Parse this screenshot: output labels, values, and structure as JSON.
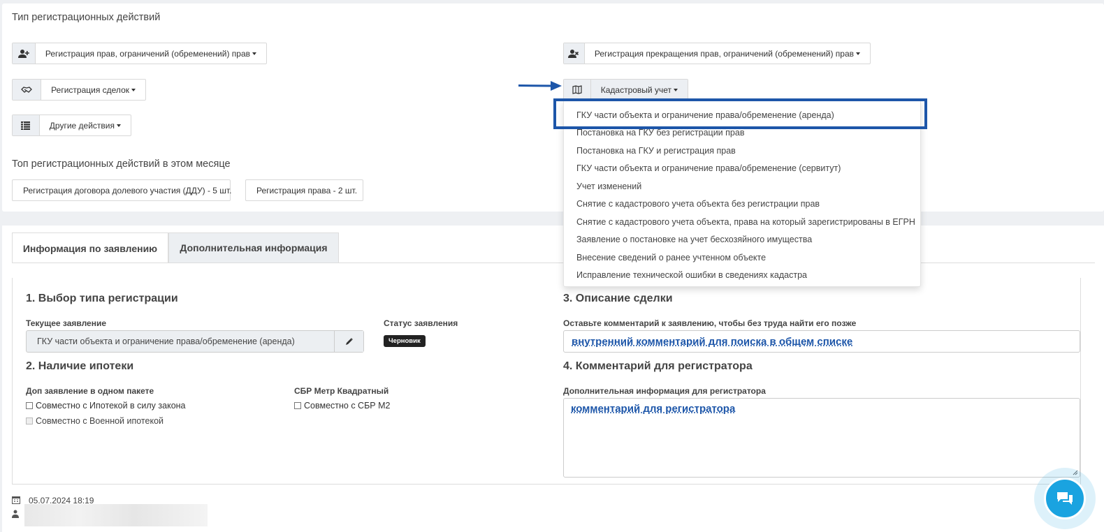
{
  "registration_types": {
    "title": "Тип регистрационных действий",
    "rights_reg": {
      "label": "Регистрация прав, ограничений (обременений) прав"
    },
    "rights_term": {
      "label": "Регистрация прекращения прав, ограничений (обременений) прав"
    },
    "deals": {
      "label": "Регистрация сделок"
    },
    "cadastral": {
      "label": "Кадастровый учет"
    },
    "other": {
      "label": "Другие действия"
    }
  },
  "top_month": {
    "title": "Топ регистрационных действий в этом месяце",
    "items": [
      "Регистрация договора долевого участия (ДДУ) - 5 шт.",
      "Регистрация права - 2 шт."
    ]
  },
  "cadastral_menu": [
    "ГКУ части объекта и ограничение права/обременение (аренда)",
    "Постановка на ГКУ без регистрации прав",
    "Постановка на ГКУ и регистрация прав",
    "ГКУ части объекта и ограничение права/обременение (сервитут)",
    "Учет изменений",
    "Снятие с кадастрового учета объекта без регистрации прав",
    "Снятие с кадастрового учета объекта, права на который зарегистрированы в ЕГРН",
    "Заявление о постановке на учет бесхозяйного имущества",
    "Внесение сведений о ранее учтенном объекте",
    "Исправление технической ошибки в сведениях кадастра"
  ],
  "tabs": [
    "Информация по заявлению",
    "Дополнительная информация"
  ],
  "form": {
    "s1_title": "1. Выбор типа регистрации",
    "current_label": "Текущее заявление",
    "current_value": "ГКУ части объекта и ограничение права/обременение (аренда)",
    "status_label": "Статус заявления",
    "status_badge": "Черновик",
    "s2_title": "2. Наличие ипотеки",
    "pkg_label": "Доп заявление в одном пакете",
    "cb_mortgage_law": "Совместно с Ипотекой в силу закона",
    "cb_military": "Совместно с Военной ипотекой",
    "sbr_label": "СБР Метр Квадратный",
    "cb_sbr": "Совместно с СБР М2",
    "s3_title": "3. Описание сделки",
    "comment_label": "Оставьте комментарий к заявлению, чтобы без труда найти его позже",
    "comment_value": "внутренний комментарий для поиска в общем списке",
    "s4_title": "4. Комментарий для регистратора",
    "registrar_label": "Дополнительная информация для регистратора",
    "registrar_value": "комментарий для регистратора"
  },
  "footer": {
    "date": "05.07.2024 18:19"
  },
  "colors": {
    "accent": "#1d56a9",
    "badge": "#222222",
    "chat": "#1aa3e0"
  },
  "icons": {
    "rights_reg": "user-plus-icon",
    "rights_term": "user-times-icon",
    "deals": "handshake-icon",
    "cadastral": "map-icon",
    "other": "list-icon",
    "edit": "pencil-icon",
    "calendar": "calendar-icon",
    "user": "user-icon",
    "chat": "chat-icon"
  }
}
